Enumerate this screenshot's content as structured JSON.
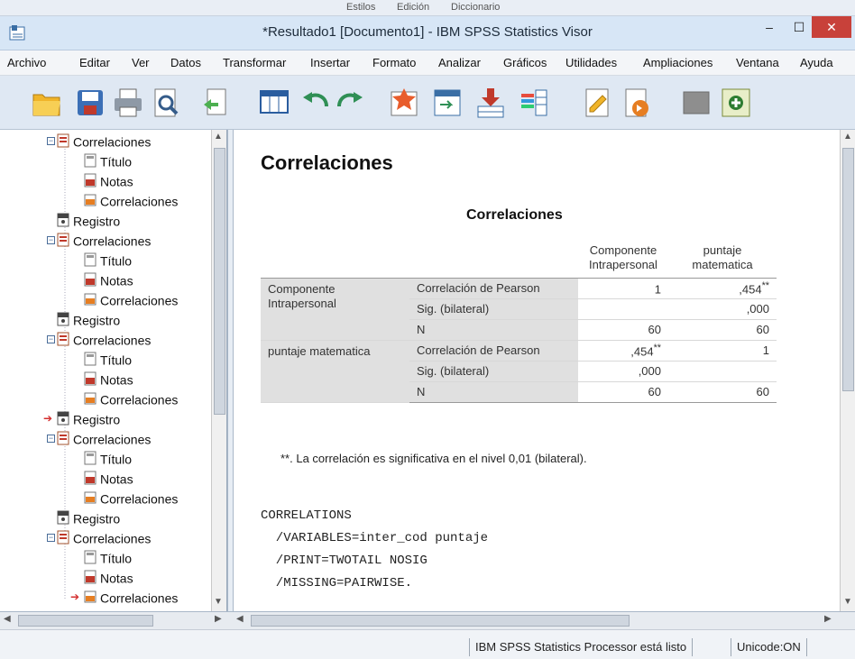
{
  "background_tabs": [
    "Estilos",
    "Edición",
    "Diccionario"
  ],
  "window": {
    "title": "*Resultado1 [Documento1] - IBM SPSS Statistics Visor",
    "minimize": "–",
    "maximize": "☐",
    "close": "✕"
  },
  "menu": [
    "Archivo",
    "Editar",
    "Ver",
    "Datos",
    "Transformar",
    "Insertar",
    "Formato",
    "Analizar",
    "Gráficos",
    "Utilidades",
    "Ampliaciones",
    "Ventana",
    "Ayuda"
  ],
  "toolbar": [
    "open-icon",
    "save-icon",
    "print-icon",
    "print-preview-icon",
    "export-icon",
    "goto-data-icon",
    "undo-icon",
    "redo-icon",
    "goto-case-icon",
    "goto-variable-icon",
    "insert-cases-icon",
    "split-file-icon",
    "designate-window-icon",
    "select-last-output-icon",
    "gray-icon",
    "add-icon"
  ],
  "tree": [
    {
      "label": "Correlaciones",
      "level": 0,
      "icon": "folder"
    },
    {
      "label": "Título",
      "level": 1,
      "icon": "title"
    },
    {
      "label": "Notas",
      "level": 1,
      "icon": "notes"
    },
    {
      "label": "Correlaciones",
      "level": 1,
      "icon": "table"
    },
    {
      "label": "Registro",
      "level": 0,
      "icon": "log"
    },
    {
      "label": "Correlaciones",
      "level": 0,
      "icon": "folder"
    },
    {
      "label": "Título",
      "level": 1,
      "icon": "title"
    },
    {
      "label": "Notas",
      "level": 1,
      "icon": "notes"
    },
    {
      "label": "Correlaciones",
      "level": 1,
      "icon": "table"
    },
    {
      "label": "Registro",
      "level": 0,
      "icon": "log"
    },
    {
      "label": "Correlaciones",
      "level": 0,
      "icon": "folder"
    },
    {
      "label": "Título",
      "level": 1,
      "icon": "title"
    },
    {
      "label": "Notas",
      "level": 1,
      "icon": "notes"
    },
    {
      "label": "Correlaciones",
      "level": 1,
      "icon": "table"
    },
    {
      "label": "Registro",
      "level": 0,
      "icon": "log",
      "arrow": true
    },
    {
      "label": "Correlaciones",
      "level": 0,
      "icon": "folder"
    },
    {
      "label": "Título",
      "level": 1,
      "icon": "title"
    },
    {
      "label": "Notas",
      "level": 1,
      "icon": "notes"
    },
    {
      "label": "Correlaciones",
      "level": 1,
      "icon": "table"
    },
    {
      "label": "Registro",
      "level": 0,
      "icon": "log"
    },
    {
      "label": "Correlaciones",
      "level": 0,
      "icon": "folder"
    },
    {
      "label": "Título",
      "level": 1,
      "icon": "title"
    },
    {
      "label": "Notas",
      "level": 1,
      "icon": "notes"
    },
    {
      "label": "Correlaciones",
      "level": 1,
      "icon": "table",
      "arrow": true
    }
  ],
  "output": {
    "heading": "Correlaciones",
    "table_title": "Correlaciones",
    "col_headers": [
      [
        "Componente",
        "Intrapersonal"
      ],
      [
        "puntaje",
        "matematica"
      ]
    ],
    "rows": [
      {
        "var": [
          "Componente",
          "Intrapersonal"
        ],
        "stat": "Correlación de Pearson",
        "c1": "1",
        "c1s": "",
        "c2": ",454",
        "c2s": "**"
      },
      {
        "var": [],
        "stat": "Sig. (bilateral)",
        "c1": "",
        "c1s": "",
        "c2": ",000",
        "c2s": ""
      },
      {
        "var": [],
        "stat": "N",
        "c1": "60",
        "c1s": "",
        "c2": "60",
        "c2s": ""
      },
      {
        "var": [
          "puntaje matematica"
        ],
        "stat": "Correlación de Pearson",
        "c1": ",454",
        "c1s": "**",
        "c2": "1",
        "c2s": ""
      },
      {
        "var": [],
        "stat": "Sig. (bilateral)",
        "c1": ",000",
        "c1s": "",
        "c2": "",
        "c2s": ""
      },
      {
        "var": [],
        "stat": "N",
        "c1": "60",
        "c1s": "",
        "c2": "60",
        "c2s": ""
      }
    ],
    "footnote": "**. La correlación es significativa en el nivel 0,01 (bilateral).",
    "syntax": [
      "CORRELATIONS",
      "  /VARIABLES=inter_cod puntaje",
      "  /PRINT=TWOTAIL NOSIG",
      "  /MISSING=PAIRWISE."
    ]
  },
  "status": {
    "processor": "IBM SPSS Statistics Processor está listo",
    "unicode": "Unicode:ON"
  }
}
